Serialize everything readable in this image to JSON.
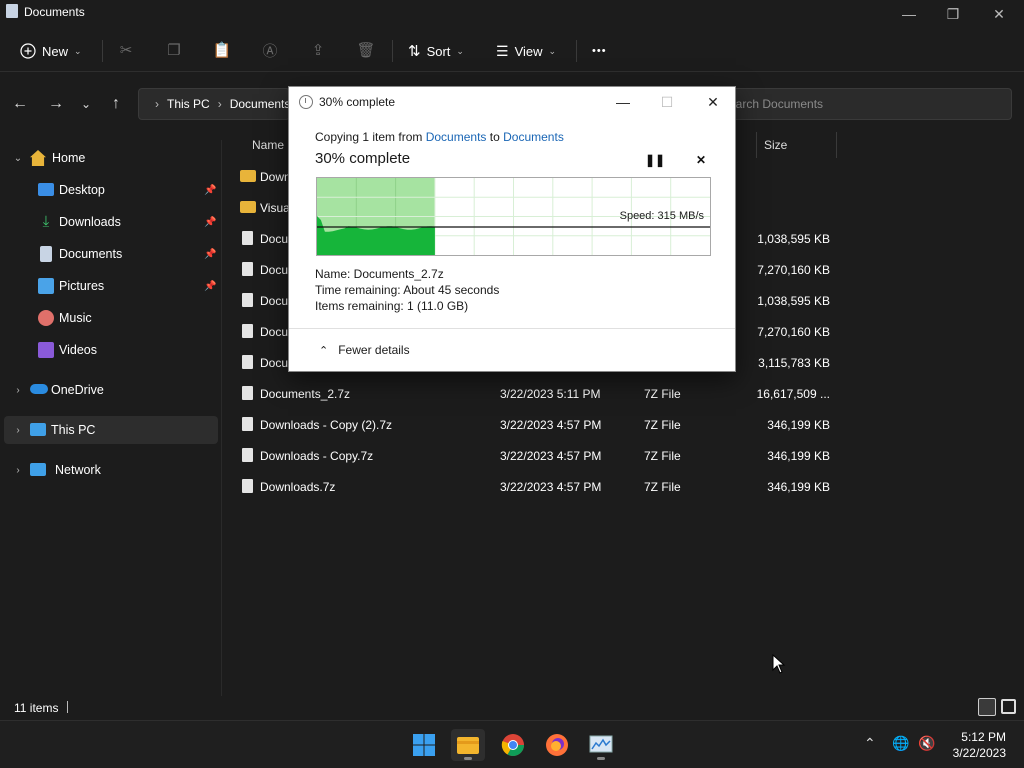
{
  "window": {
    "title": "Documents",
    "controls": {
      "minimize": "—",
      "maximize": "❐",
      "close": "✕"
    }
  },
  "toolbar": {
    "new_label": "New",
    "sort_label": "Sort",
    "view_label": "View",
    "more_label": "•••"
  },
  "nav": {
    "back": "←",
    "forward": "→",
    "recent": "⌄",
    "up": "↑",
    "breadcrumb": [
      "This PC",
      "Documents"
    ],
    "search_placeholder": "Search Documents"
  },
  "sidebar": {
    "items": [
      {
        "label": "Home"
      },
      {
        "label": "Desktop"
      },
      {
        "label": "Downloads"
      },
      {
        "label": "Documents"
      },
      {
        "label": "Pictures"
      },
      {
        "label": "Music"
      },
      {
        "label": "Videos"
      },
      {
        "label": "OneDrive"
      },
      {
        "label": "This PC"
      },
      {
        "label": "Network"
      }
    ]
  },
  "filelist": {
    "columns": {
      "name": "Name",
      "size": "Size"
    },
    "rows": [
      {
        "name": "Downloads",
        "date": "",
        "type": "",
        "size": ""
      },
      {
        "name": "Visual Studio",
        "date": "",
        "type": "",
        "size": ""
      },
      {
        "name": "Documents",
        "date": "",
        "type": "",
        "size": "1,038,595 KB"
      },
      {
        "name": "Documents",
        "date": "",
        "type": "",
        "size": "7,270,160 KB"
      },
      {
        "name": "Documents",
        "date": "",
        "type": "",
        "size": "1,038,595 KB"
      },
      {
        "name": "Documents",
        "date": "",
        "type": "",
        "size": "7,270,160 KB"
      },
      {
        "name": "Documents",
        "date": "",
        "type": "",
        "size": "3,115,783 KB"
      },
      {
        "name": "Documents_2.7z",
        "date": "3/22/2023 5:11 PM",
        "type": "7Z File",
        "size": "16,617,509 ..."
      },
      {
        "name": "Downloads - Copy (2).7z",
        "date": "3/22/2023 4:57 PM",
        "type": "7Z File",
        "size": "346,199 KB"
      },
      {
        "name": "Downloads - Copy.7z",
        "date": "3/22/2023 4:57 PM",
        "type": "7Z File",
        "size": "346,199 KB"
      },
      {
        "name": "Downloads.7z",
        "date": "3/22/2023 4:57 PM",
        "type": "7Z File",
        "size": "346,199 KB"
      }
    ]
  },
  "status": {
    "item_count": "11 items"
  },
  "dialog": {
    "title": "30% complete",
    "copying_prefix": "Copying 1 item from",
    "from": "Documents",
    "to_word": "to",
    "to": "Documents",
    "percent_heading": "30% complete",
    "progress_fraction": 0.3,
    "speed": "Speed: 315 MB/s",
    "name_line": "Name:  Documents_2.7z",
    "time_line": "Time remaining:  About 45 seconds",
    "items_line": "Items remaining:  1 (11.0 GB)",
    "fewer_details": "Fewer details",
    "pause_icon": "pause-icon",
    "cancel_icon": "close-icon"
  },
  "taskbar": {
    "apps": [
      "start-icon",
      "file-explorer-icon",
      "chrome-icon",
      "firefox-icon",
      "resource-monitor-icon"
    ],
    "time": "5:12 PM",
    "date": "3/22/2023"
  },
  "colors": {
    "accent_link": "#1a66b5",
    "graph_fill_dark": "#16b53a",
    "graph_fill_light": "#a6e3a1",
    "folder": "#e8b43a"
  }
}
